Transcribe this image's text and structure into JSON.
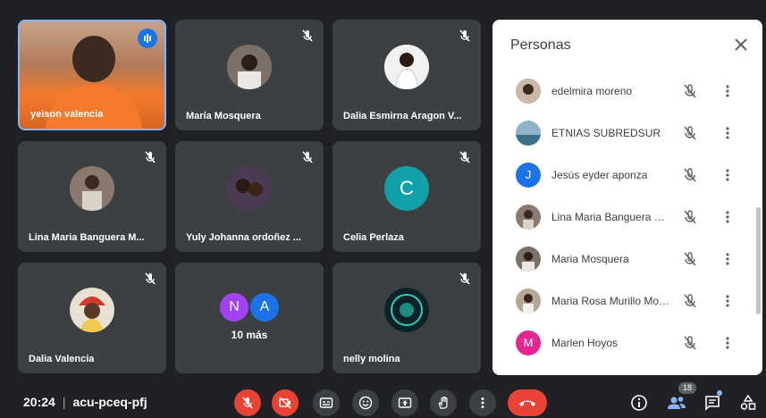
{
  "tiles": [
    {
      "name": "yeison valencia"
    },
    {
      "name": "María Mosquera"
    },
    {
      "name": "Dalia Esmirna Aragon V..."
    },
    {
      "name": "Lina Maria Banguera M..."
    },
    {
      "name": "Yuly Johanna ordoñez ..."
    },
    {
      "name": "Celia Perlaza",
      "initial": "C"
    },
    {
      "name": "Dalia Valencia"
    },
    {
      "more_label": "10 más",
      "initials": [
        "N",
        "A"
      ]
    },
    {
      "name": "nelly molina"
    }
  ],
  "panel": {
    "title": "Personas",
    "people": [
      {
        "name": "edelmira moreno"
      },
      {
        "name": "ETNIAS SUBREDSUR"
      },
      {
        "name": "Jesús eyder aponza",
        "initial": "J"
      },
      {
        "name": "Lina Maria Banguera Ma..."
      },
      {
        "name": "Maria Mosquera"
      },
      {
        "name": "Maria Rosa Murillo Mos..."
      },
      {
        "name": "Marlen Hoyos",
        "initial": "M"
      }
    ]
  },
  "bottombar": {
    "time": "20:24",
    "separator": "|",
    "meeting_code": "acu-pceq-pfj",
    "participants_count": "18"
  },
  "colors": {
    "accent": "#1a73e8",
    "danger": "#ea4335",
    "tile_bg": "#3c4043",
    "page_bg": "#202124",
    "celia_avatar": "#12a1a8",
    "n_avatar": "#a142f4",
    "a_avatar": "#1a73e8",
    "j_avatar": "#1a73e8",
    "m_avatar": "#e52592"
  }
}
